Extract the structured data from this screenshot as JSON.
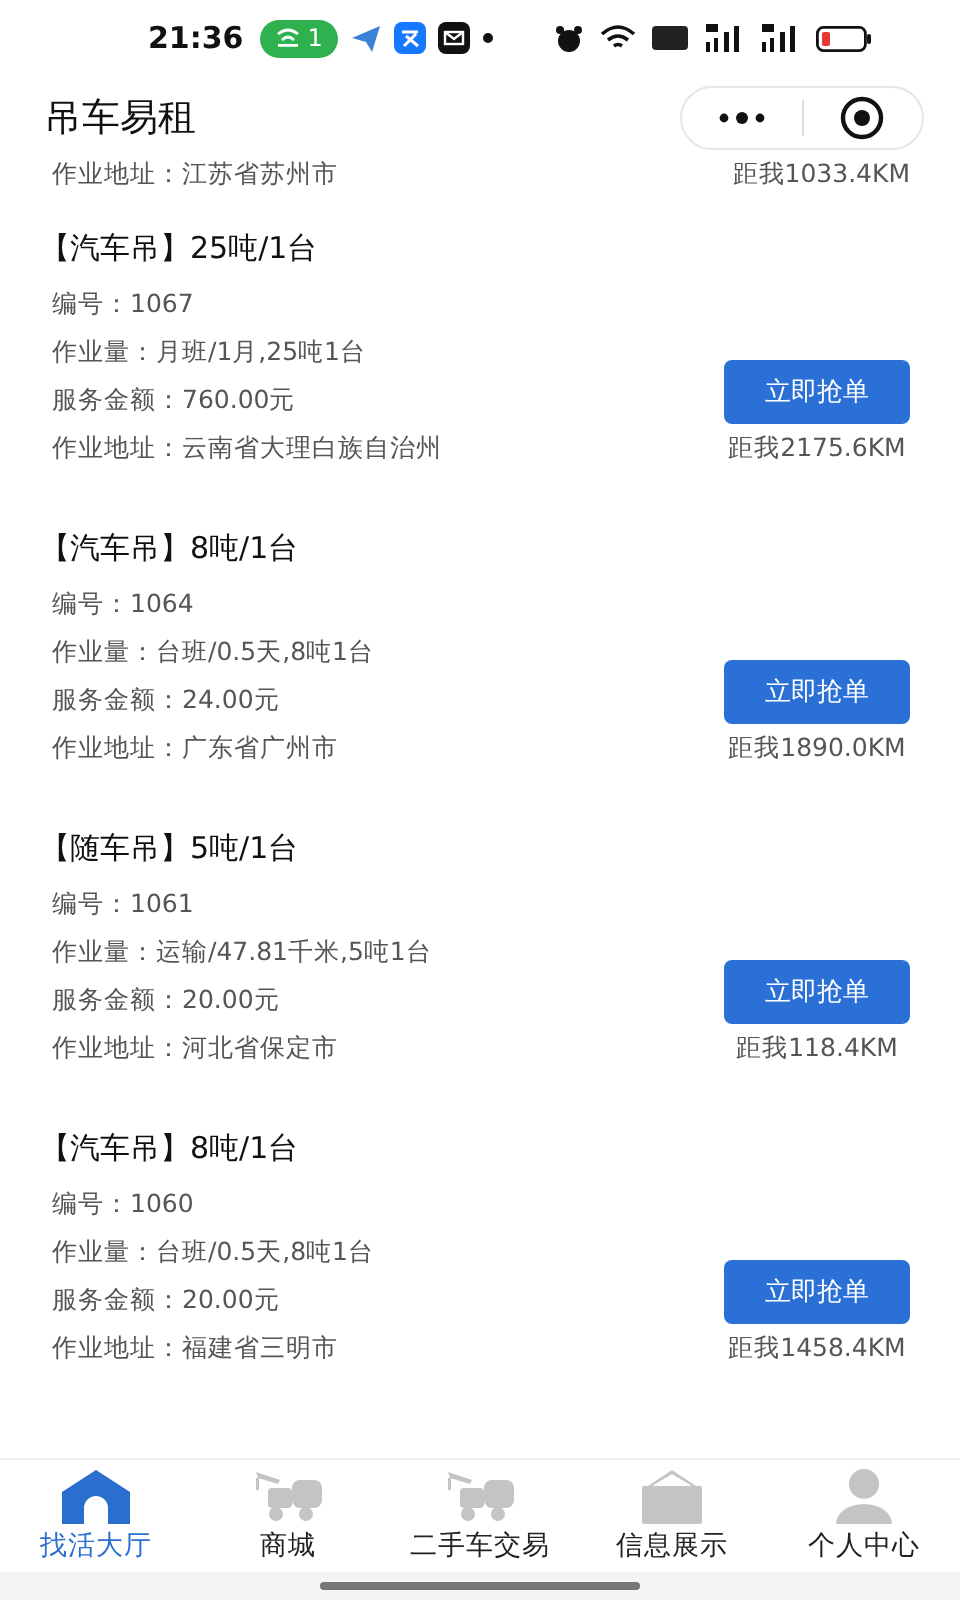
{
  "status_bar": {
    "time": "21:36",
    "badge": "1"
  },
  "header": {
    "title": "吊车易租"
  },
  "partial_order": {
    "address": "作业地址：江苏省苏州市",
    "distance": "距我1033.4KM"
  },
  "orders": [
    {
      "title": "【汽车吊】25吨/1台",
      "number": "编号：1067",
      "workload": "作业量：月班/1月,25吨1台",
      "amount": "服务金额：760.00元",
      "address": "作业地址：云南省大理白族自治州",
      "button": "立即抢单",
      "distance": "距我2175.6KM"
    },
    {
      "title": "【汽车吊】8吨/1台",
      "number": "编号：1064",
      "workload": "作业量：台班/0.5天,8吨1台",
      "amount": "服务金额：24.00元",
      "address": "作业地址：广东省广州市",
      "button": "立即抢单",
      "distance": "距我1890.0KM"
    },
    {
      "title": "【随车吊】5吨/1台",
      "number": "编号：1061",
      "workload": "作业量：运输/47.81千米,5吨1台",
      "amount": "服务金额：20.00元",
      "address": "作业地址：河北省保定市",
      "button": "立即抢单",
      "distance": "距我118.4KM"
    },
    {
      "title": "【汽车吊】8吨/1台",
      "number": "编号：1060",
      "workload": "作业量：台班/0.5天,8吨1台",
      "amount": "服务金额：20.00元",
      "address": "作业地址：福建省三明市",
      "button": "立即抢单",
      "distance": "距我1458.4KM"
    }
  ],
  "tab_bar": [
    {
      "kind": "home",
      "label": "找活大厅",
      "selected": true
    },
    {
      "kind": "crane",
      "label": "商城",
      "selected": false
    },
    {
      "kind": "crane",
      "label": "二手车交易",
      "selected": false
    },
    {
      "kind": "job",
      "label": "信息展示",
      "selected": false
    },
    {
      "kind": "person",
      "label": "个人中心",
      "selected": false
    }
  ]
}
